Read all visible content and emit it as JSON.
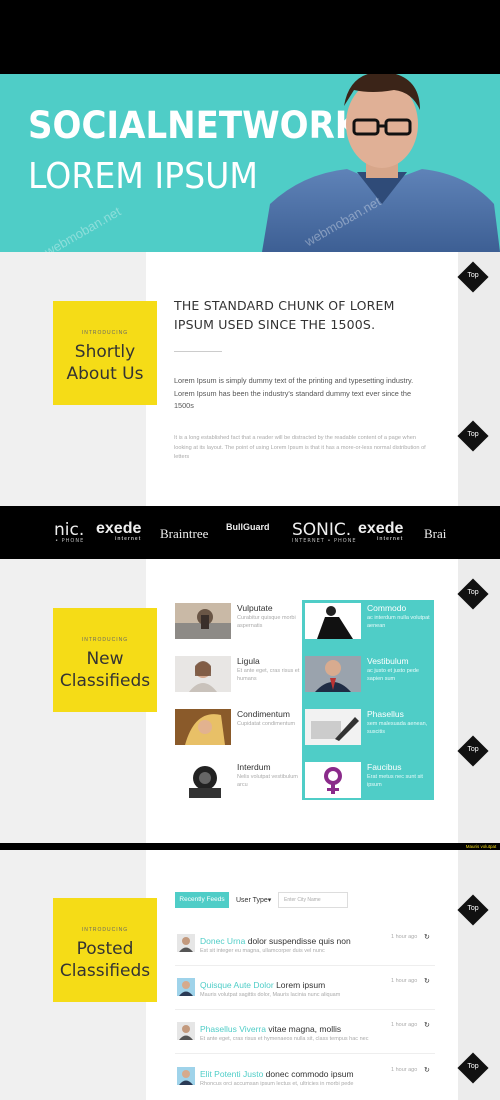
{
  "hero": {
    "title": "SOCIALNETWORK",
    "subtitle": "LOREM IPSUM"
  },
  "about": {
    "label": "INTRODUCING",
    "title_line1": "Shortly",
    "title_line2": "About Us",
    "heading": "THE STANDARD CHUNK OF LOREM IPSUM USED SINCE THE 1500S.",
    "paragraph1": "Lorem Ipsum is simply dummy text of the printing and typesetting industry. Lorem Ipsum has been the industry's standard dummy text ever since the 1500s",
    "paragraph2": "It is a long established fact that a reader will be distracted by the readable content of a page when looking at its layout. The point of using Lorem Ipsum is that it has a more-or-less normal distribution of letters"
  },
  "top_label": "Top",
  "brands": {
    "items": [
      {
        "name": "nic.",
        "sub": "• PHONE"
      },
      {
        "name": "exede",
        "sub": "internet"
      },
      {
        "name": "Braintree",
        "sub": ""
      },
      {
        "name": "BullGuard",
        "sub": ""
      },
      {
        "name": "SONIC.",
        "sub": "INTERNET • PHONE"
      },
      {
        "name": "exede",
        "sub": "internet"
      },
      {
        "name": "Brai",
        "sub": ""
      }
    ]
  },
  "classifieds": {
    "label": "INTRODUCING",
    "title_line1": "New",
    "title_line2": "Classifieds",
    "items": [
      {
        "title": "Vulputate",
        "desc": "Curabitur quisque morbi aspernatis"
      },
      {
        "title": "Ligula",
        "desc": "Et ante eget, cras risus et humans"
      },
      {
        "title": "Condimentum",
        "desc": "Cupidatat condimentum"
      },
      {
        "title": "Interdum",
        "desc": "Nelis volutpat vestibulum arcu"
      },
      {
        "title": "Commodo",
        "desc": "ac interdum nulla volutpat aenean"
      },
      {
        "title": "Vestibulum",
        "desc": "ac justo et justo pede sapien sum"
      },
      {
        "title": "Phasellus",
        "desc": "sem malesuada aenean, suscitis"
      },
      {
        "title": "Faucibus",
        "desc": "Erat metus nec sunt sit ipsum"
      }
    ]
  },
  "feeds": {
    "badge": "Mauris volutpat",
    "label": "INTRODUCING",
    "title_line1": "Posted",
    "title_line2": "Classifieds",
    "tab_label": "Recently Feeds",
    "user_type": "User Type▾",
    "city_placeholder": "Enter City Name",
    "rows": [
      {
        "name": "Donec Urna",
        "text": " dolor suspendisse quis non",
        "sub": "Est sit integer eu magna, ullamcorper duis vel nunc",
        "time": "1 hour ago"
      },
      {
        "name": "Quisque Aute Dolor",
        "text": " Lorem ipsum",
        "sub": "Mauris volutpat sagittis dolor, Mauris lacinia nunc aliquam",
        "time": "1 hour ago"
      },
      {
        "name": "Phasellus Viverra",
        "text": " vitae magna, mollis",
        "sub": "Et ante eget, cras risus et hymenaeos nulla sit, class tempus hac nec",
        "time": "1 hour ago"
      },
      {
        "name": "Elit Potenti Justo",
        "text": " donec commodo ipsum",
        "sub": "Rhoncus orci accumsan ipsum lectus et, ultricies in morbi pede",
        "time": "1 hour ago"
      }
    ]
  },
  "colors": {
    "teal": "#4fcdc7",
    "yellow": "#f5dc17",
    "black": "#000000"
  }
}
